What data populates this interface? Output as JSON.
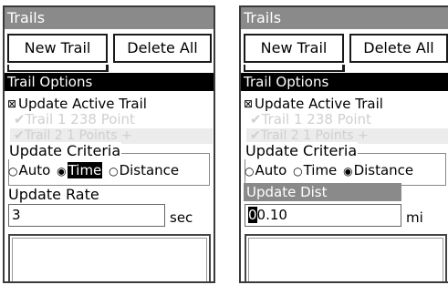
{
  "screens": [
    {
      "title": "Trails",
      "new_trail_label": "New Trail",
      "delete_all_label": "Delete All",
      "options_title": "Trail Options",
      "checkbox_label": "Update Active Trail",
      "checkbox_checked": true,
      "bg_trail_row1": "✔Trail 1        238 Point",
      "bg_trail_row2": "✔Trail 2         1 Points    +",
      "criteria_label": "Update Criteria",
      "radios": [
        {
          "label": "Auto",
          "selected": false
        },
        {
          "label": "Time",
          "selected": true
        },
        {
          "label": "Distance",
          "selected": false
        }
      ],
      "field_label": "Update Rate",
      "field_label_highlighted": false,
      "field_cursor": "",
      "field_value": "3",
      "field_unit": "sec"
    },
    {
      "title": "Trails",
      "new_trail_label": "New Trail",
      "delete_all_label": "Delete All",
      "options_title": "Trail Options",
      "checkbox_label": "Update Active Trail",
      "checkbox_checked": true,
      "bg_trail_row1": "✔Trail 1        238 Point",
      "bg_trail_row2": "✔Trail 2         1 Points    +",
      "criteria_label": "Update Criteria",
      "radios": [
        {
          "label": "Auto",
          "selected": false
        },
        {
          "label": "Time",
          "selected": false
        },
        {
          "label": "Distance",
          "selected": true
        }
      ],
      "field_label": "Update Dist",
      "field_label_highlighted": true,
      "field_cursor": "0",
      "field_value": "0.10",
      "field_unit": "mi"
    }
  ],
  "glyphs": {
    "checkbox_checked": "⊠",
    "radio_on": "◉",
    "radio_off": "○"
  }
}
